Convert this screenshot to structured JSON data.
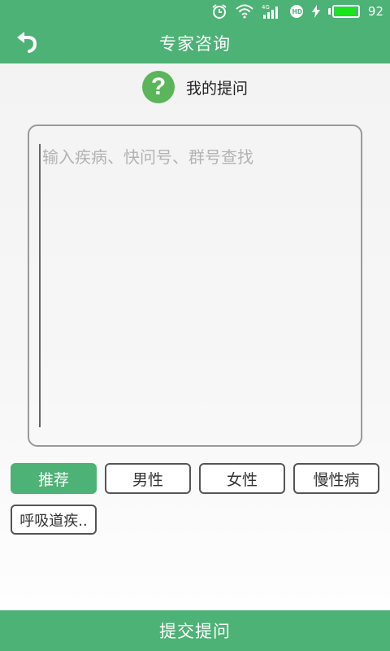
{
  "status_bar": {
    "battery_level": "92",
    "icons": [
      "alarm-icon",
      "wifi-icon",
      "signal-4g-icon",
      "hd-icon",
      "charging-icon",
      "battery-icon"
    ],
    "battery_fill_fraction": 0.92
  },
  "header": {
    "title": "专家咨询",
    "back_icon": "back-arrow-icon"
  },
  "section": {
    "icon": "question-icon",
    "icon_glyph": "?",
    "title": "我的提问"
  },
  "question_input": {
    "placeholder": "输入疾病、快问号、群号查找",
    "value": ""
  },
  "tags": [
    {
      "label": "推荐",
      "selected": true
    },
    {
      "label": "男性",
      "selected": false
    },
    {
      "label": "女性",
      "selected": false
    },
    {
      "label": "慢性病",
      "selected": false
    },
    {
      "label": "呼吸道疾..",
      "selected": false
    }
  ],
  "submit_button": {
    "label": "提交提问"
  },
  "colors": {
    "brand_green": "#4db275",
    "icon_green": "#5bb55b",
    "battery_green": "#19e619"
  }
}
